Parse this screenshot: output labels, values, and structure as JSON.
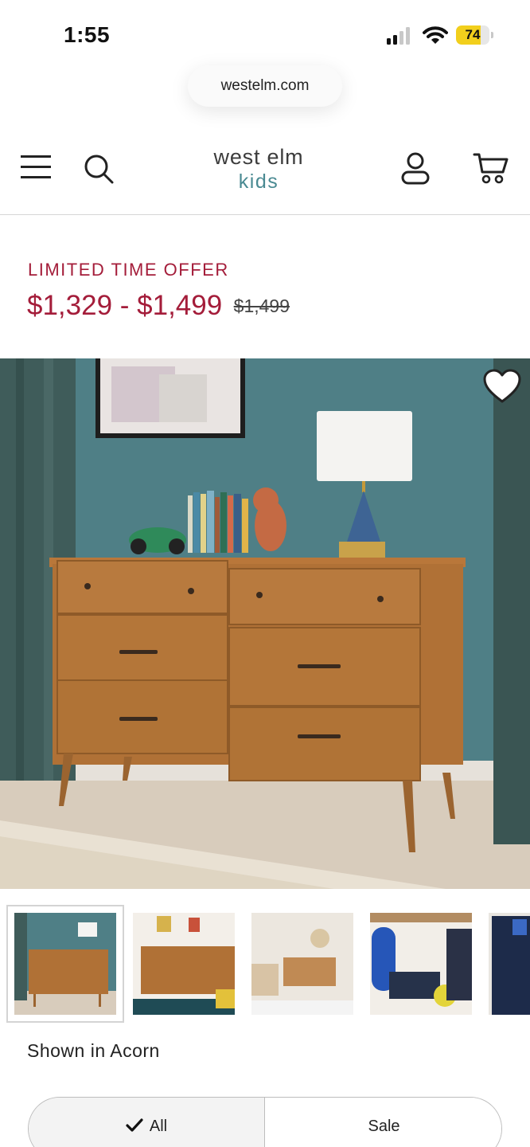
{
  "status_bar": {
    "time": "1:55",
    "battery_percent": "74",
    "battery_level": 0.74,
    "battery_color": "#f2cf1c"
  },
  "browser": {
    "url": "westelm.com"
  },
  "header": {
    "logo_line1": "west elm",
    "logo_line2": "kids",
    "icons": [
      "menu-icon",
      "search-icon",
      "account-icon",
      "cart-icon"
    ]
  },
  "product": {
    "promo_label": "LIMITED TIME OFFER",
    "price_range": "$1,329 - $1,499",
    "original_price": "$1,499",
    "shown_in": "Shown in Acorn",
    "accent_color": "#a41d3a"
  },
  "gallery": {
    "wishlist_icon": "heart-icon",
    "thumbnail_count": 5,
    "selected_index": 0
  },
  "filter": {
    "options": [
      {
        "label": "All",
        "selected": true
      },
      {
        "label": "Sale",
        "selected": false
      }
    ]
  }
}
